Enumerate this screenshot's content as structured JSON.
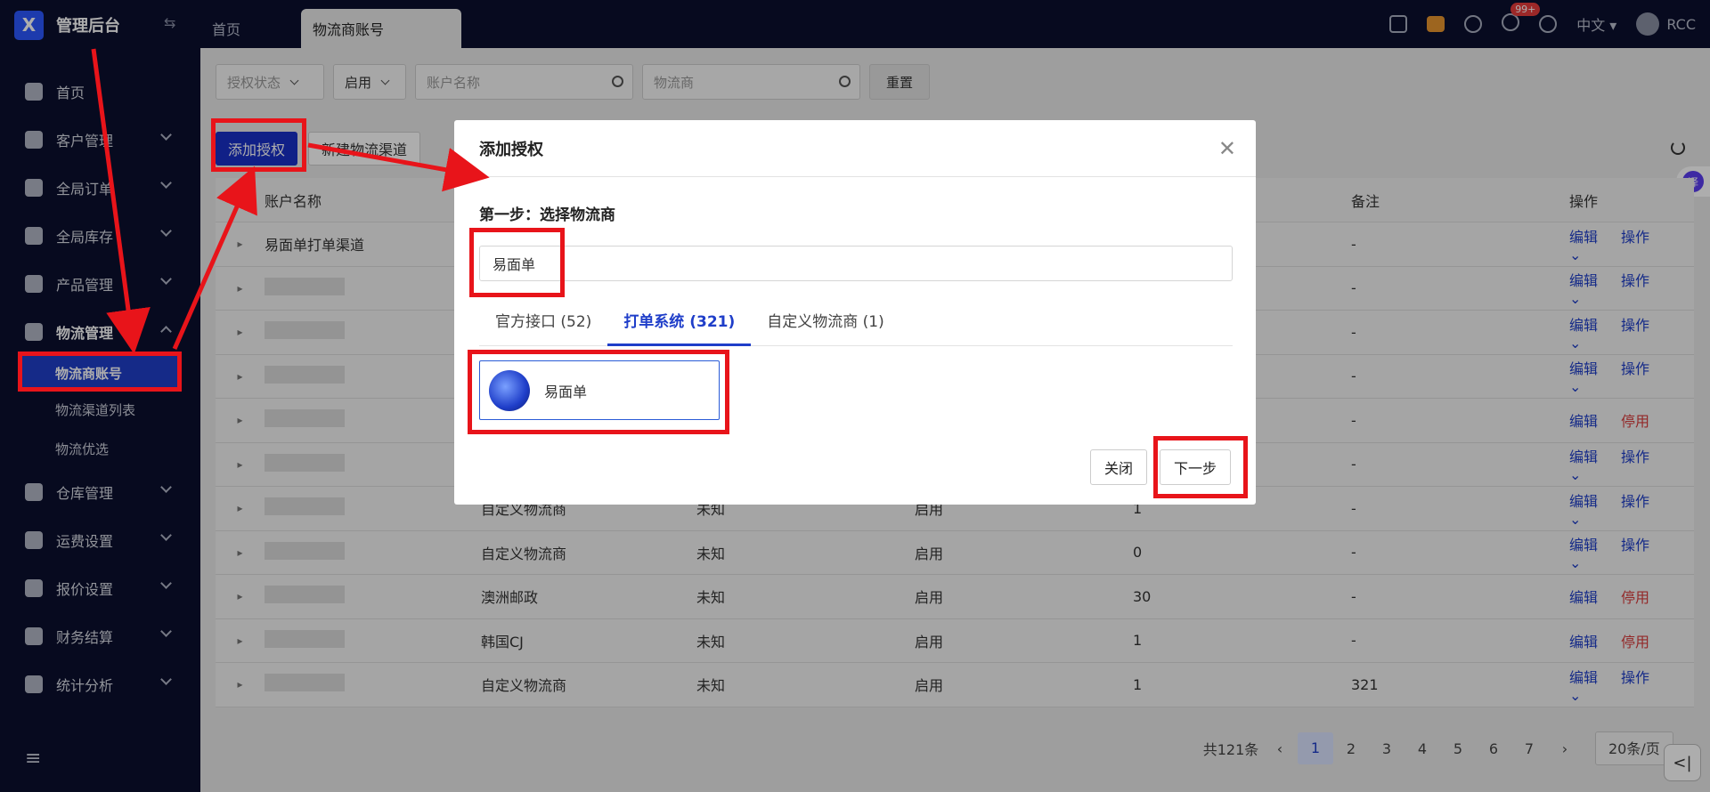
{
  "app": {
    "title": "管理后台"
  },
  "tabs": [
    {
      "label": "首页"
    },
    {
      "label": "物流商账号"
    }
  ],
  "header": {
    "badge": "99+",
    "language": "中文",
    "user": "RCC"
  },
  "sidebar": {
    "items": [
      {
        "label": "首页"
      },
      {
        "label": "客户管理"
      },
      {
        "label": "全局订单"
      },
      {
        "label": "全局库存"
      },
      {
        "label": "产品管理"
      },
      {
        "label": "物流管理"
      },
      {
        "label": "仓库管理"
      },
      {
        "label": "运费设置"
      },
      {
        "label": "报价设置"
      },
      {
        "label": "财务结算"
      },
      {
        "label": "统计分析"
      }
    ],
    "subitems": [
      {
        "label": "物流商账号"
      },
      {
        "label": "物流渠道列表"
      },
      {
        "label": "物流优选"
      }
    ]
  },
  "filters": {
    "auth_status": "授权状态",
    "enabled": "启用",
    "account_placeholder": "账户名称",
    "carrier_placeholder": "物流商",
    "reset": "重置"
  },
  "toolbar": {
    "add_auth": "添加授权",
    "new_channel": "新建物流渠道"
  },
  "table": {
    "headers": [
      "账户名称",
      "",
      "",
      "",
      "",
      "备注",
      "操作"
    ],
    "rows": [
      {
        "name": "易面单打单渠道",
        "carrier": "",
        "unknown": "",
        "status": "",
        "count": "",
        "remark": "-",
        "edit": "编辑",
        "action": "操作"
      },
      {
        "name": "",
        "carrier": "",
        "unknown": "",
        "status": "",
        "count": "",
        "remark": "-",
        "edit": "编辑",
        "action": "操作"
      },
      {
        "name": "",
        "carrier": "",
        "unknown": "",
        "status": "",
        "count": "",
        "remark": "-",
        "edit": "编辑",
        "action": "操作"
      },
      {
        "name": "",
        "carrier": "",
        "unknown": "",
        "status": "",
        "count": "",
        "remark": "-",
        "edit": "编辑",
        "action": "操作"
      },
      {
        "name": "",
        "carrier": "",
        "unknown": "",
        "status": "",
        "count": "",
        "remark": "-",
        "edit": "编辑",
        "action": "停用"
      },
      {
        "name": "",
        "carrier": "",
        "unknown": "",
        "status": "",
        "count": "",
        "remark": "-",
        "edit": "编辑",
        "action": "操作"
      },
      {
        "name": "",
        "carrier": "自定义物流商",
        "unknown": "未知",
        "status": "启用",
        "count": "1",
        "remark": "-",
        "edit": "编辑",
        "action": "操作"
      },
      {
        "name": "",
        "carrier": "自定义物流商",
        "unknown": "未知",
        "status": "启用",
        "count": "0",
        "remark": "-",
        "edit": "编辑",
        "action": "操作"
      },
      {
        "name": "",
        "carrier": "澳洲邮政",
        "unknown": "未知",
        "status": "启用",
        "count": "30",
        "remark": "-",
        "edit": "编辑",
        "action": "停用"
      },
      {
        "name": "",
        "carrier": "韩国CJ",
        "unknown": "未知",
        "status": "启用",
        "count": "1",
        "remark": "-",
        "edit": "编辑",
        "action": "停用"
      },
      {
        "name": "",
        "carrier": "自定义物流商",
        "unknown": "未知",
        "status": "启用",
        "count": "1",
        "remark": "321",
        "edit": "编辑",
        "action": "操作"
      }
    ]
  },
  "pagination": {
    "total": "共121条",
    "pages": [
      "1",
      "2",
      "3",
      "4",
      "5",
      "6",
      "7"
    ],
    "page_size": "20条/页"
  },
  "modal": {
    "title": "添加授权",
    "step": "第一步：选择物流商",
    "search_value": "易面单",
    "tabs": [
      {
        "label": "官方接口 (52)"
      },
      {
        "label": "打单系统 (321)"
      },
      {
        "label": "自定义物流商 (1)"
      }
    ],
    "card": {
      "name": "易面单"
    },
    "close": "关闭",
    "next": "下一步"
  },
  "colors": {
    "accent": "#1f3ec9",
    "sidebar_bg": "#0b0f2e",
    "annotation": "#e8141a"
  }
}
